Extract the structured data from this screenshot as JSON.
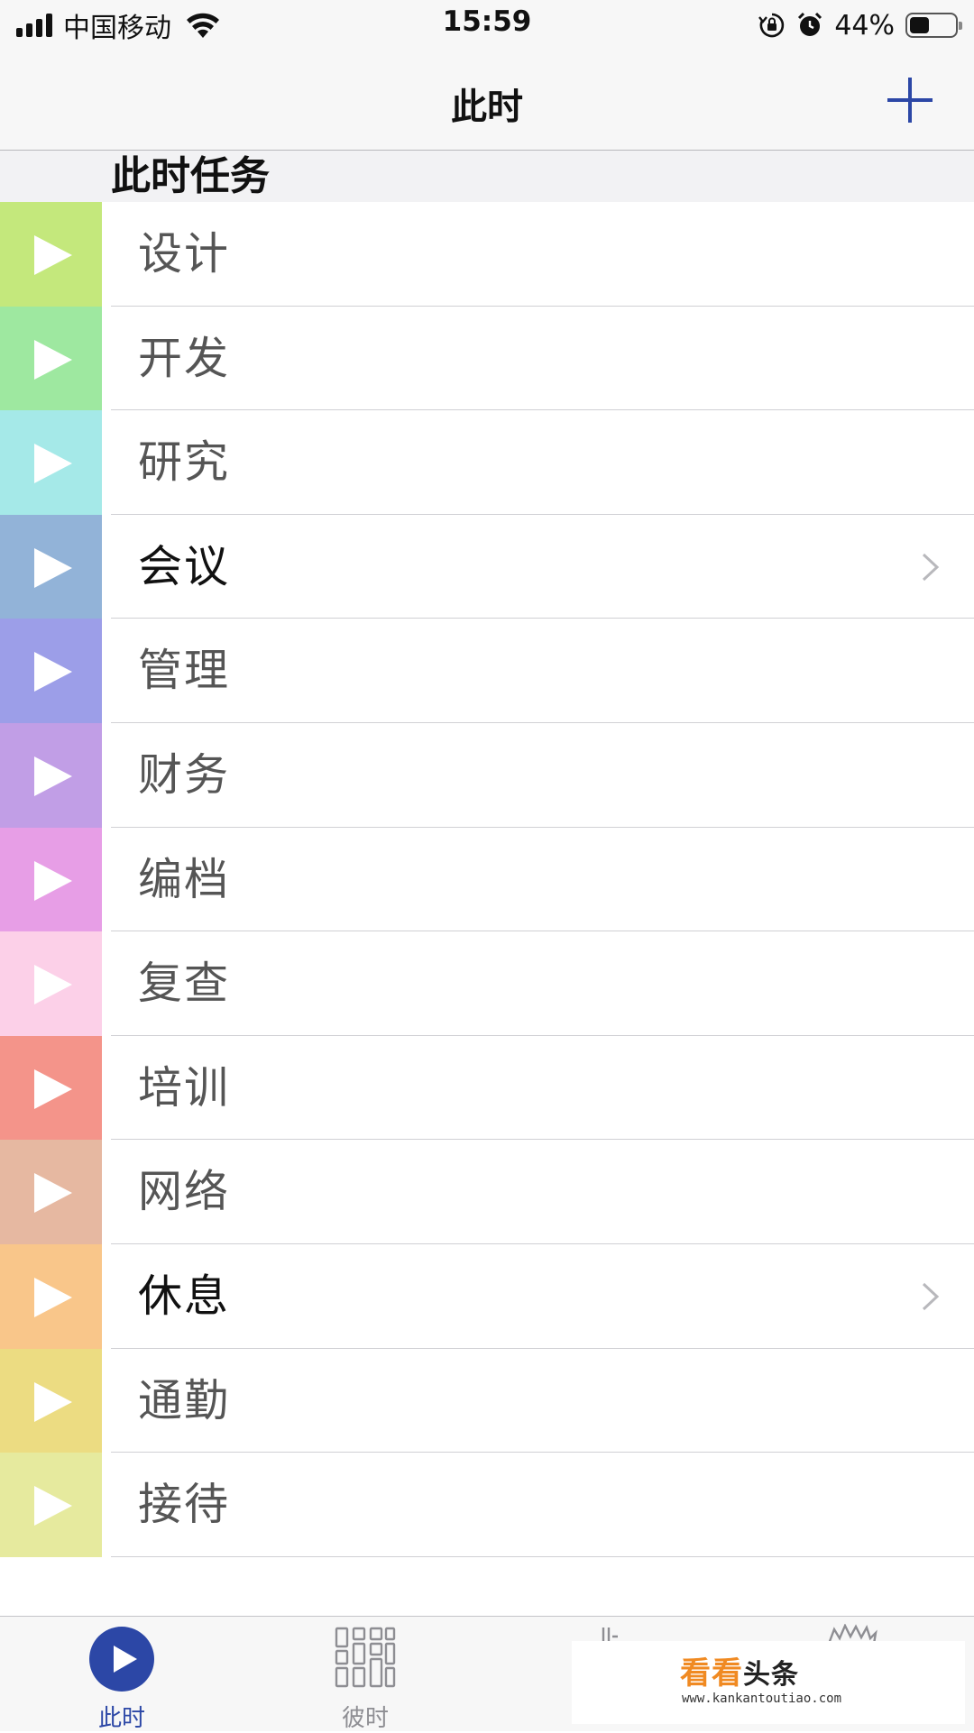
{
  "status_bar": {
    "carrier": "中国移动",
    "time": "15:59",
    "battery_percent": "44%",
    "battery_level": 0.44,
    "icons": [
      "signal-icon",
      "wifi-icon",
      "orientation-lock-icon",
      "alarm-icon",
      "battery-icon"
    ]
  },
  "nav": {
    "title": "此时",
    "add_icon": "plus-icon",
    "accent_color": "#2c47a6"
  },
  "section": {
    "title": "此时任务"
  },
  "tasks": [
    {
      "label": "设计",
      "color": "#c4e87c",
      "has_detail": false
    },
    {
      "label": "开发",
      "color": "#9ee8a0",
      "has_detail": false
    },
    {
      "label": "研究",
      "color": "#a5e9e8",
      "has_detail": false
    },
    {
      "label": "会议",
      "color": "#92b3d8",
      "has_detail": true
    },
    {
      "label": "管理",
      "color": "#9c9ee8",
      "has_detail": false
    },
    {
      "label": "财务",
      "color": "#c19ee6",
      "has_detail": false
    },
    {
      "label": "编档",
      "color": "#e79ee6",
      "has_detail": false
    },
    {
      "label": "复查",
      "color": "#fcd0e8",
      "has_detail": false
    },
    {
      "label": "培训",
      "color": "#f4948a",
      "has_detail": false
    },
    {
      "label": "网络",
      "color": "#e6b8a1",
      "has_detail": false
    },
    {
      "label": "休息",
      "color": "#f9c68a",
      "has_detail": true
    },
    {
      "label": "通勤",
      "color": "#ecdc82",
      "has_detail": false
    },
    {
      "label": "接待",
      "color": "#e6ea9e",
      "has_detail": false
    }
  ],
  "tab_bar": {
    "tabs": [
      {
        "label": "此时",
        "icon": "play-circle-icon",
        "active": true
      },
      {
        "label": "彼时",
        "icon": "grid-icon",
        "active": false
      },
      {
        "label": "",
        "icon": "chart-icon",
        "active": false
      },
      {
        "label": "",
        "icon": "burst-icon",
        "active": false
      }
    ]
  },
  "watermark": {
    "text_a": "看看",
    "text_b": "头条",
    "url": "www.kankantoutiao.com"
  }
}
